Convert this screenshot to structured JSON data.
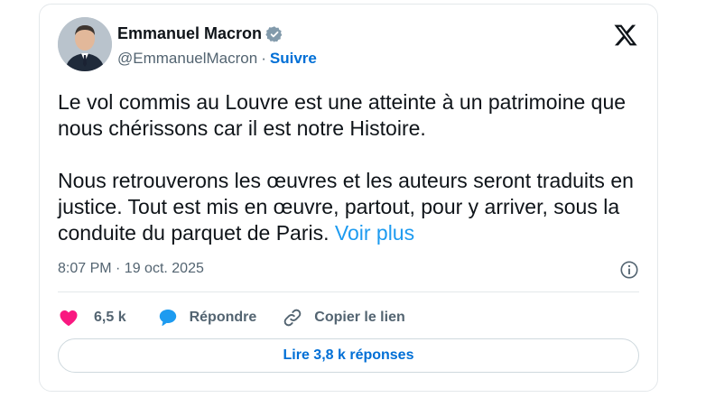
{
  "author": {
    "name": "Emmanuel Macron",
    "handle": "@EmmanuelMacron",
    "separator": "·",
    "follow_label": "Suivre",
    "avatar_icon": "avatar-photo",
    "verified_icon": "verified-badge-icon"
  },
  "brand_icon": "x-logo-icon",
  "tweet": {
    "paragraph1": "Le vol commis au Louvre est une atteinte à un patrimoine que nous chérissons car il est notre Histoire.",
    "paragraph2": "Nous retrouverons les œuvres et les auteurs seront traduits en justice. Tout est mis en œuvre, partout, pour y arriver, sous la conduite du parquet de Paris.",
    "more_label": "Voir plus"
  },
  "meta": {
    "time_date": "8:07 PM · 19 oct. 2025",
    "info_icon": "info-icon"
  },
  "actions": {
    "like_count": "6,5 k",
    "reply_label": "Répondre",
    "copy_label": "Copier le lien"
  },
  "read_replies_label": "Lire 3,8 k réponses",
  "colors": {
    "accent_blue": "#1d9bf0",
    "link_blue": "#006fd6",
    "like_pink": "#f91880",
    "reply_blue": "#1d9bf0",
    "secondary_text": "#536471",
    "border": "#e4e8eb"
  }
}
